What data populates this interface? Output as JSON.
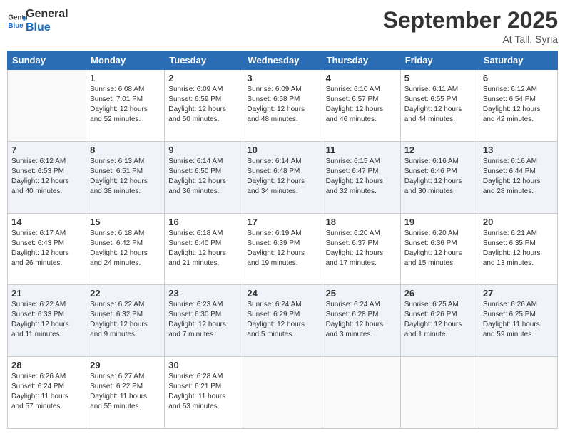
{
  "header": {
    "logo_line1": "General",
    "logo_line2": "Blue",
    "month": "September 2025",
    "location": "At Tall, Syria"
  },
  "days_of_week": [
    "Sunday",
    "Monday",
    "Tuesday",
    "Wednesday",
    "Thursday",
    "Friday",
    "Saturday"
  ],
  "weeks": [
    [
      {
        "day": "",
        "info": ""
      },
      {
        "day": "1",
        "info": "Sunrise: 6:08 AM\nSunset: 7:01 PM\nDaylight: 12 hours\nand 52 minutes."
      },
      {
        "day": "2",
        "info": "Sunrise: 6:09 AM\nSunset: 6:59 PM\nDaylight: 12 hours\nand 50 minutes."
      },
      {
        "day": "3",
        "info": "Sunrise: 6:09 AM\nSunset: 6:58 PM\nDaylight: 12 hours\nand 48 minutes."
      },
      {
        "day": "4",
        "info": "Sunrise: 6:10 AM\nSunset: 6:57 PM\nDaylight: 12 hours\nand 46 minutes."
      },
      {
        "day": "5",
        "info": "Sunrise: 6:11 AM\nSunset: 6:55 PM\nDaylight: 12 hours\nand 44 minutes."
      },
      {
        "day": "6",
        "info": "Sunrise: 6:12 AM\nSunset: 6:54 PM\nDaylight: 12 hours\nand 42 minutes."
      }
    ],
    [
      {
        "day": "7",
        "info": "Sunrise: 6:12 AM\nSunset: 6:53 PM\nDaylight: 12 hours\nand 40 minutes."
      },
      {
        "day": "8",
        "info": "Sunrise: 6:13 AM\nSunset: 6:51 PM\nDaylight: 12 hours\nand 38 minutes."
      },
      {
        "day": "9",
        "info": "Sunrise: 6:14 AM\nSunset: 6:50 PM\nDaylight: 12 hours\nand 36 minutes."
      },
      {
        "day": "10",
        "info": "Sunrise: 6:14 AM\nSunset: 6:48 PM\nDaylight: 12 hours\nand 34 minutes."
      },
      {
        "day": "11",
        "info": "Sunrise: 6:15 AM\nSunset: 6:47 PM\nDaylight: 12 hours\nand 32 minutes."
      },
      {
        "day": "12",
        "info": "Sunrise: 6:16 AM\nSunset: 6:46 PM\nDaylight: 12 hours\nand 30 minutes."
      },
      {
        "day": "13",
        "info": "Sunrise: 6:16 AM\nSunset: 6:44 PM\nDaylight: 12 hours\nand 28 minutes."
      }
    ],
    [
      {
        "day": "14",
        "info": "Sunrise: 6:17 AM\nSunset: 6:43 PM\nDaylight: 12 hours\nand 26 minutes."
      },
      {
        "day": "15",
        "info": "Sunrise: 6:18 AM\nSunset: 6:42 PM\nDaylight: 12 hours\nand 24 minutes."
      },
      {
        "day": "16",
        "info": "Sunrise: 6:18 AM\nSunset: 6:40 PM\nDaylight: 12 hours\nand 21 minutes."
      },
      {
        "day": "17",
        "info": "Sunrise: 6:19 AM\nSunset: 6:39 PM\nDaylight: 12 hours\nand 19 minutes."
      },
      {
        "day": "18",
        "info": "Sunrise: 6:20 AM\nSunset: 6:37 PM\nDaylight: 12 hours\nand 17 minutes."
      },
      {
        "day": "19",
        "info": "Sunrise: 6:20 AM\nSunset: 6:36 PM\nDaylight: 12 hours\nand 15 minutes."
      },
      {
        "day": "20",
        "info": "Sunrise: 6:21 AM\nSunset: 6:35 PM\nDaylight: 12 hours\nand 13 minutes."
      }
    ],
    [
      {
        "day": "21",
        "info": "Sunrise: 6:22 AM\nSunset: 6:33 PM\nDaylight: 12 hours\nand 11 minutes."
      },
      {
        "day": "22",
        "info": "Sunrise: 6:22 AM\nSunset: 6:32 PM\nDaylight: 12 hours\nand 9 minutes."
      },
      {
        "day": "23",
        "info": "Sunrise: 6:23 AM\nSunset: 6:30 PM\nDaylight: 12 hours\nand 7 minutes."
      },
      {
        "day": "24",
        "info": "Sunrise: 6:24 AM\nSunset: 6:29 PM\nDaylight: 12 hours\nand 5 minutes."
      },
      {
        "day": "25",
        "info": "Sunrise: 6:24 AM\nSunset: 6:28 PM\nDaylight: 12 hours\nand 3 minutes."
      },
      {
        "day": "26",
        "info": "Sunrise: 6:25 AM\nSunset: 6:26 PM\nDaylight: 12 hours\nand 1 minute."
      },
      {
        "day": "27",
        "info": "Sunrise: 6:26 AM\nSunset: 6:25 PM\nDaylight: 11 hours\nand 59 minutes."
      }
    ],
    [
      {
        "day": "28",
        "info": "Sunrise: 6:26 AM\nSunset: 6:24 PM\nDaylight: 11 hours\nand 57 minutes."
      },
      {
        "day": "29",
        "info": "Sunrise: 6:27 AM\nSunset: 6:22 PM\nDaylight: 11 hours\nand 55 minutes."
      },
      {
        "day": "30",
        "info": "Sunrise: 6:28 AM\nSunset: 6:21 PM\nDaylight: 11 hours\nand 53 minutes."
      },
      {
        "day": "",
        "info": ""
      },
      {
        "day": "",
        "info": ""
      },
      {
        "day": "",
        "info": ""
      },
      {
        "day": "",
        "info": ""
      }
    ]
  ]
}
